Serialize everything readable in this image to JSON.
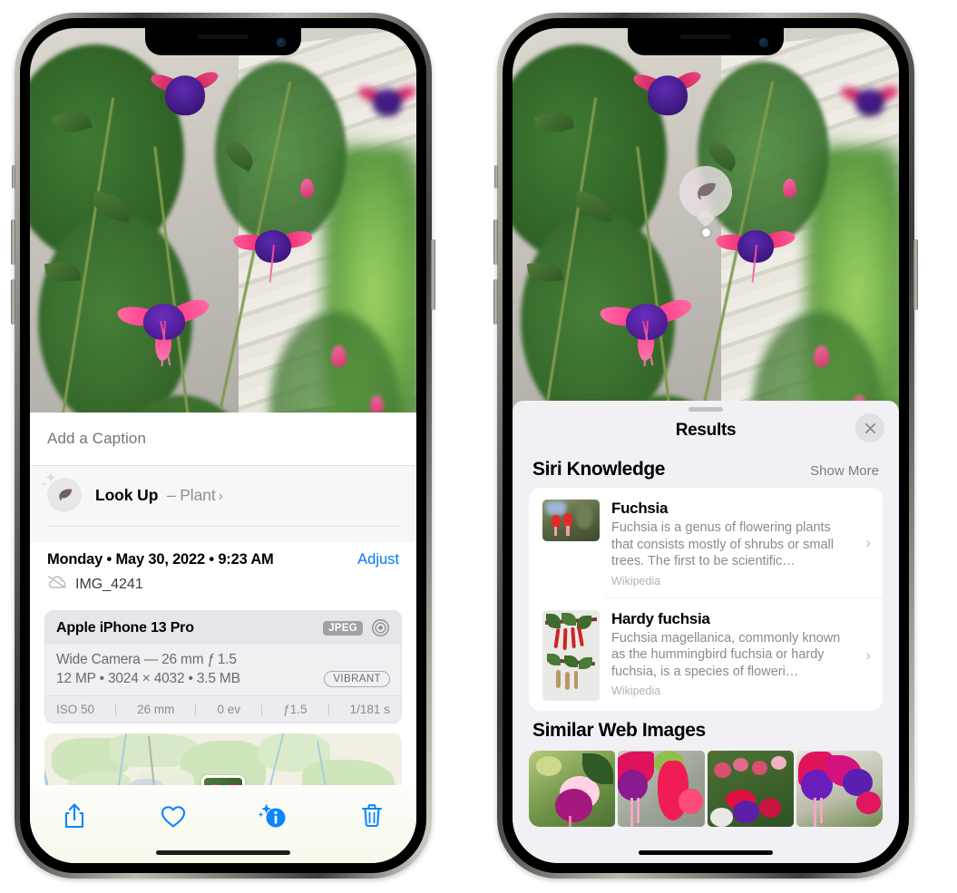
{
  "left_phone": {
    "caption_field": {
      "placeholder": "Add a Caption",
      "value": ""
    },
    "lookup": {
      "label": "Look Up",
      "dash": "–",
      "subject": "Plant",
      "chevron": "›",
      "icon": "leaf-icon"
    },
    "meta": {
      "date": "Monday • May 30, 2022 • 9:23 AM",
      "adjust_label": "Adjust",
      "filename": "IMG_4241",
      "cloud_icon": "cloud-slash-icon"
    },
    "camera_card": {
      "model": "Apple iPhone 13 Pro",
      "format_tag": "JPEG",
      "aperture_icon": "aperture-icon",
      "lens": "Wide Camera — 26 mm ƒ 1.5",
      "resolution": "12 MP • 3024 × 4032 • 3.5 MB",
      "style_tag": "VIBRANT",
      "exif": [
        "ISO 50",
        "26 mm",
        "0 ev",
        "ƒ1.5",
        "1/181 s"
      ]
    },
    "toolbar": [
      {
        "name": "share-button",
        "icon": "share-icon"
      },
      {
        "name": "favorite-button",
        "icon": "heart-icon"
      },
      {
        "name": "info-button",
        "icon": "info-sparkle-icon"
      },
      {
        "name": "delete-button",
        "icon": "trash-icon"
      }
    ]
  },
  "right_phone": {
    "bubble": {
      "icon": "leaf-icon"
    },
    "sheet": {
      "title": "Results",
      "close_icon": "close-icon",
      "sections": [
        {
          "title": "Siri Knowledge",
          "action": "Show More",
          "cards": [
            {
              "title": "Fuchsia",
              "description": "Fuchsia is a genus of flowering plants that consists mostly of shrubs or small trees. The first to be scientific…",
              "source": "Wikipedia",
              "chevron": "›"
            },
            {
              "title": "Hardy fuchsia",
              "description": "Fuchsia magellanica, commonly known as the hummingbird fuchsia or hardy fuchsia, is a species of floweri…",
              "source": "Wikipedia",
              "chevron": "›"
            }
          ]
        },
        {
          "title": "Similar Web Images",
          "images": [
            "web-image-1",
            "web-image-2",
            "web-image-3",
            "web-image-4"
          ]
        }
      ]
    }
  },
  "colors": {
    "accent_blue": "#007aff",
    "sheet_bg": "#f1f0f5",
    "card_bg": "#ffffff",
    "secondary_text": "#8a8a90"
  }
}
